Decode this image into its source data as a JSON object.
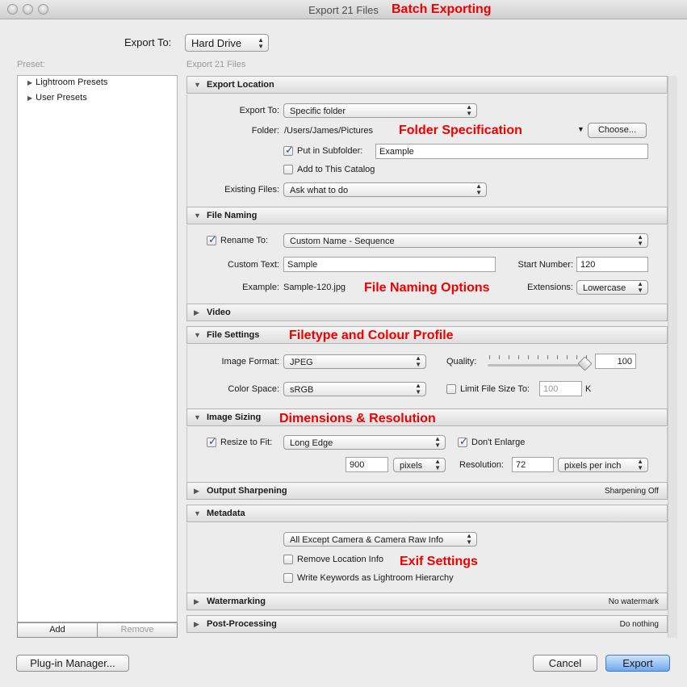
{
  "window": {
    "title": "Export 21 Files"
  },
  "annotations": {
    "batch": "Batch Exporting",
    "folder": "Folder Specification",
    "naming": "File Naming Options",
    "filetype": "Filetype and Colour Profile",
    "dimensions": "Dimensions & Resolution",
    "exif": "Exif Settings"
  },
  "export_to": {
    "label": "Export To:",
    "value": "Hard Drive"
  },
  "preset": {
    "label": "Preset:",
    "items": [
      "Lightroom Presets",
      "User Presets"
    ],
    "add": "Add",
    "remove": "Remove"
  },
  "files_header": "Export 21 Files",
  "sections": {
    "export_location": {
      "title": "Export Location",
      "export_to_label": "Export To:",
      "export_to_value": "Specific folder",
      "folder_label": "Folder:",
      "folder_value": "/Users/James/Pictures",
      "choose": "Choose...",
      "subfolder_label": "Put in Subfolder:",
      "subfolder_value": "Example",
      "add_catalog": "Add to This Catalog",
      "existing_label": "Existing Files:",
      "existing_value": "Ask what to do"
    },
    "file_naming": {
      "title": "File Naming",
      "rename_label": "Rename To:",
      "rename_value": "Custom Name - Sequence",
      "custom_label": "Custom Text:",
      "custom_value": "Sample",
      "start_label": "Start Number:",
      "start_value": "120",
      "example_label": "Example:",
      "example_value": "Sample-120.jpg",
      "ext_label": "Extensions:",
      "ext_value": "Lowercase"
    },
    "video": {
      "title": "Video"
    },
    "file_settings": {
      "title": "File Settings",
      "format_label": "Image Format:",
      "format_value": "JPEG",
      "quality_label": "Quality:",
      "quality_value": "100",
      "color_label": "Color Space:",
      "color_value": "sRGB",
      "limit_label": "Limit File Size To:",
      "limit_value": "100",
      "limit_unit": "K"
    },
    "image_sizing": {
      "title": "Image Sizing",
      "resize_label": "Resize to Fit:",
      "resize_value": "Long Edge",
      "dont_enlarge": "Don't Enlarge",
      "size_value": "900",
      "size_unit": "pixels",
      "res_label": "Resolution:",
      "res_value": "72",
      "res_unit": "pixels per inch"
    },
    "output_sharpening": {
      "title": "Output Sharpening",
      "status": "Sharpening Off"
    },
    "metadata": {
      "title": "Metadata",
      "include_value": "All Except Camera & Camera Raw Info",
      "remove_location": "Remove Location Info",
      "write_keywords": "Write Keywords as Lightroom Hierarchy"
    },
    "watermarking": {
      "title": "Watermarking",
      "status": "No watermark"
    },
    "post_processing": {
      "title": "Post-Processing",
      "status": "Do nothing"
    }
  },
  "footer": {
    "plugin_manager": "Plug-in Manager...",
    "cancel": "Cancel",
    "export": "Export"
  }
}
